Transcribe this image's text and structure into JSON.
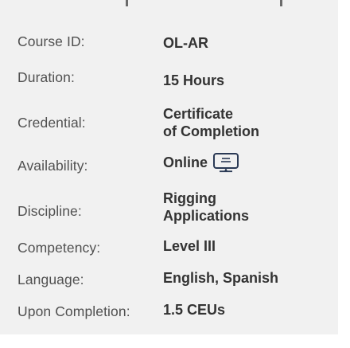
{
  "details": [
    {
      "label": "Course ID:",
      "value": "OL-AR"
    },
    {
      "label": "Duration:",
      "value": "15 Hours"
    },
    {
      "label": "Credential:",
      "value_lines": [
        "Certificate",
        "of Completion"
      ]
    },
    {
      "label": "Availability:",
      "value": "Online",
      "icon": "monitor-icon"
    },
    {
      "label": "Discipline:",
      "value_lines": [
        "Rigging",
        "Applications"
      ]
    },
    {
      "label": "Competency:",
      "value": "Level III"
    },
    {
      "label": "Language:",
      "value": "English, Spanish"
    },
    {
      "label": "Upon Completion:",
      "value": "1.5 CEUs"
    }
  ],
  "colors": {
    "card_bg": "#f1f1f1",
    "label": "#505050",
    "value": "#333333"
  }
}
